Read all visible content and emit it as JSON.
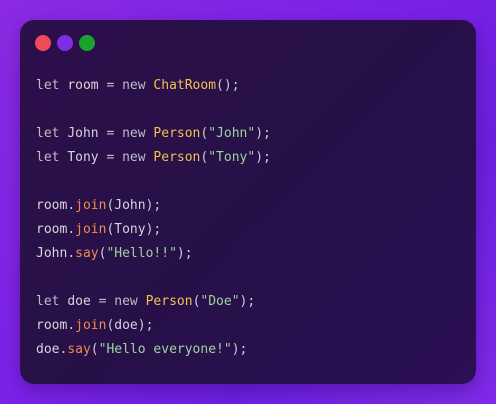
{
  "window": {
    "controls": [
      {
        "name": "close",
        "color": "#ef4b5a"
      },
      {
        "name": "minimize",
        "color": "#7d2ee6"
      },
      {
        "name": "maximize",
        "color": "#18a52c"
      }
    ]
  },
  "code": {
    "lines": [
      [
        {
          "t": "let",
          "k": "kw"
        },
        {
          "t": " "
        },
        {
          "t": "room",
          "k": "id"
        },
        {
          "t": " "
        },
        {
          "t": "=",
          "k": "op"
        },
        {
          "t": " "
        },
        {
          "t": "new",
          "k": "kw"
        },
        {
          "t": " "
        },
        {
          "t": "ChatRoom",
          "k": "cls"
        },
        {
          "t": "();",
          "k": "punc"
        }
      ],
      [],
      [
        {
          "t": "let",
          "k": "kw"
        },
        {
          "t": " "
        },
        {
          "t": "John",
          "k": "id"
        },
        {
          "t": " "
        },
        {
          "t": "=",
          "k": "op"
        },
        {
          "t": " "
        },
        {
          "t": "new",
          "k": "kw"
        },
        {
          "t": " "
        },
        {
          "t": "Person",
          "k": "cls"
        },
        {
          "t": "(",
          "k": "punc"
        },
        {
          "t": "\"John\"",
          "k": "str"
        },
        {
          "t": ");",
          "k": "punc"
        }
      ],
      [
        {
          "t": "let",
          "k": "kw"
        },
        {
          "t": " "
        },
        {
          "t": "Tony",
          "k": "id"
        },
        {
          "t": " "
        },
        {
          "t": "=",
          "k": "op"
        },
        {
          "t": " "
        },
        {
          "t": "new",
          "k": "kw"
        },
        {
          "t": " "
        },
        {
          "t": "Person",
          "k": "cls"
        },
        {
          "t": "(",
          "k": "punc"
        },
        {
          "t": "\"Tony\"",
          "k": "str"
        },
        {
          "t": ");",
          "k": "punc"
        }
      ],
      [],
      [
        {
          "t": "room",
          "k": "id"
        },
        {
          "t": ".",
          "k": "punc"
        },
        {
          "t": "join",
          "k": "fn"
        },
        {
          "t": "(",
          "k": "punc"
        },
        {
          "t": "John",
          "k": "id"
        },
        {
          "t": ");",
          "k": "punc"
        }
      ],
      [
        {
          "t": "room",
          "k": "id"
        },
        {
          "t": ".",
          "k": "punc"
        },
        {
          "t": "join",
          "k": "fn"
        },
        {
          "t": "(",
          "k": "punc"
        },
        {
          "t": "Tony",
          "k": "id"
        },
        {
          "t": ");",
          "k": "punc"
        }
      ],
      [
        {
          "t": "John",
          "k": "id"
        },
        {
          "t": ".",
          "k": "punc"
        },
        {
          "t": "say",
          "k": "fn"
        },
        {
          "t": "(",
          "k": "punc"
        },
        {
          "t": "\"Hello!!\"",
          "k": "str"
        },
        {
          "t": ");",
          "k": "punc"
        }
      ],
      [],
      [
        {
          "t": "let",
          "k": "kw"
        },
        {
          "t": " "
        },
        {
          "t": "doe",
          "k": "id"
        },
        {
          "t": " "
        },
        {
          "t": "=",
          "k": "op"
        },
        {
          "t": " "
        },
        {
          "t": "new",
          "k": "kw"
        },
        {
          "t": " "
        },
        {
          "t": "Person",
          "k": "cls"
        },
        {
          "t": "(",
          "k": "punc"
        },
        {
          "t": "\"Doe\"",
          "k": "str"
        },
        {
          "t": ");",
          "k": "punc"
        }
      ],
      [
        {
          "t": "room",
          "k": "id"
        },
        {
          "t": ".",
          "k": "punc"
        },
        {
          "t": "join",
          "k": "fn"
        },
        {
          "t": "(",
          "k": "punc"
        },
        {
          "t": "doe",
          "k": "id"
        },
        {
          "t": ");",
          "k": "punc"
        }
      ],
      [
        {
          "t": "doe",
          "k": "id"
        },
        {
          "t": ".",
          "k": "punc"
        },
        {
          "t": "say",
          "k": "fn"
        },
        {
          "t": "(",
          "k": "punc"
        },
        {
          "t": "\"Hello everyone!\"",
          "k": "str"
        },
        {
          "t": ");",
          "k": "punc"
        }
      ]
    ]
  }
}
